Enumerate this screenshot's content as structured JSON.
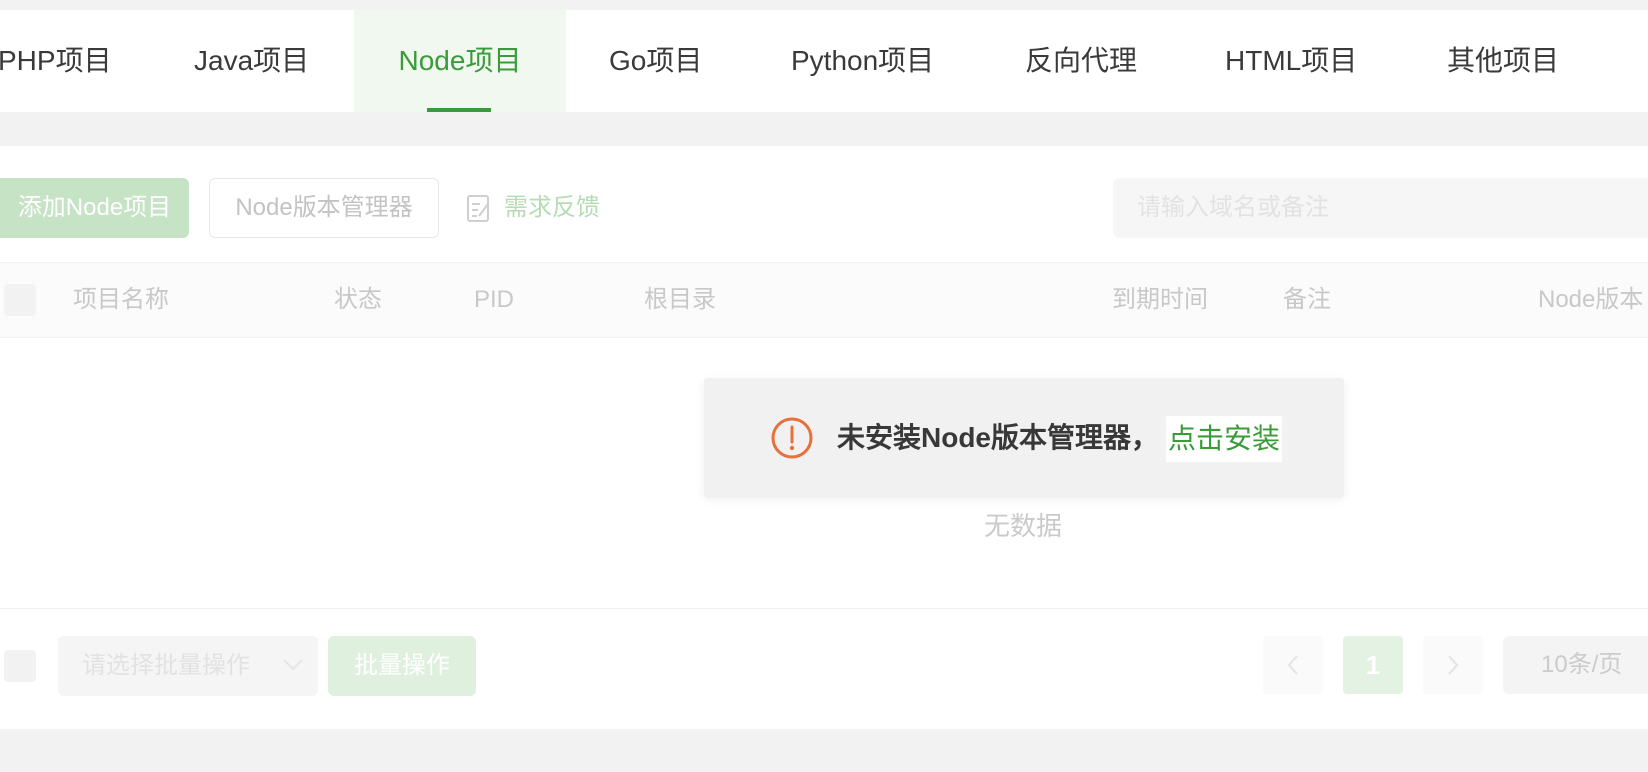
{
  "tabs": [
    {
      "label": "PHP项目",
      "active": false
    },
    {
      "label": "Java项目",
      "active": false
    },
    {
      "label": "Node项目",
      "active": true
    },
    {
      "label": "Go项目",
      "active": false
    },
    {
      "label": "Python项目",
      "active": false
    },
    {
      "label": "反向代理",
      "active": false
    },
    {
      "label": "HTML项目",
      "active": false
    },
    {
      "label": "其他项目",
      "active": false
    }
  ],
  "toolbar": {
    "add_label": "添加Node项目",
    "manager_label": "Node版本管理器",
    "feedback_label": "需求反馈",
    "search_placeholder": "请输入域名或备注"
  },
  "table": {
    "columns": [
      "项目名称",
      "状态",
      "PID",
      "根目录",
      "到期时间",
      "备注",
      "Node版本"
    ],
    "empty_text": "无数据"
  },
  "footer": {
    "batch_placeholder": "请选择批量操作",
    "batch_button": "批量操作",
    "current_page": "1",
    "page_size": "10条/页"
  },
  "modal": {
    "message": "未安装Node版本管理器，",
    "link": "点击安装"
  },
  "colors": {
    "accent": "#3b9b3a",
    "warning": "#e8703a",
    "background": "#f2f2f2"
  }
}
